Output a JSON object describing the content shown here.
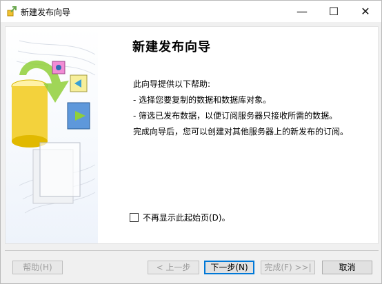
{
  "window": {
    "title": "新建发布向导",
    "controls": {
      "minimize": "—",
      "maximize": "☐",
      "close": "✕"
    }
  },
  "page": {
    "title": "新建发布向导",
    "intro": "此向导提供以下帮助:",
    "bullets": [
      "- 选择您要复制的数据和数据库对象。",
      "- 筛选已发布数据，以便订阅服务器只接收所需的数据。"
    ],
    "outro": "完成向导后，您可以创建对其他服务器上的新发布的订阅。",
    "checkbox_label": "不再显示此起始页(D)。",
    "checkbox_checked": false
  },
  "buttons": {
    "help": "帮助(H)",
    "back": "< 上一步",
    "next": "下一步(N)",
    "finish": "完成(F) >>|",
    "cancel": "取消"
  },
  "colors": {
    "accent": "#0078d7",
    "cylinder": "#f3d23c",
    "arrow": "#8fcf3a"
  }
}
